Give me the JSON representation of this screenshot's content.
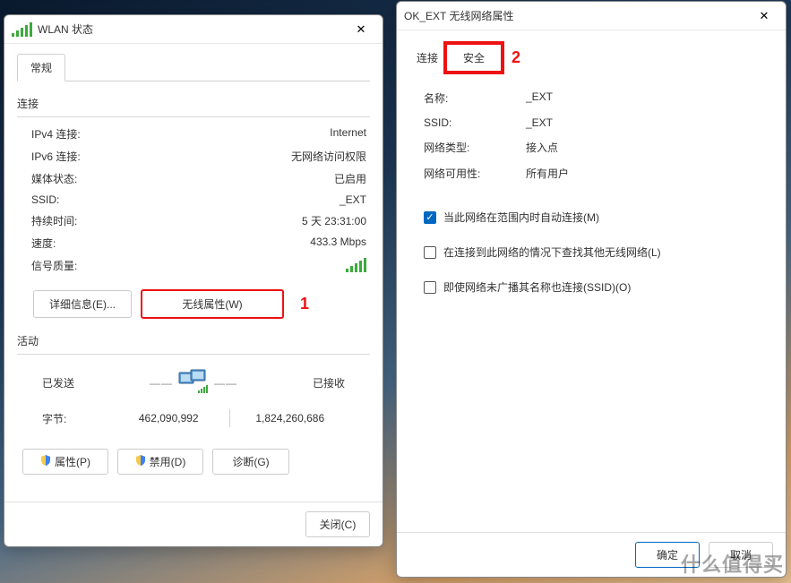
{
  "dlg1": {
    "title": "WLAN 状态",
    "tab_general": "常规",
    "section_connection": "连接",
    "rows": {
      "ipv4_label": "IPv4 连接:",
      "ipv4_value": "Internet",
      "ipv6_label": "IPv6 连接:",
      "ipv6_value": "无网络访问权限",
      "media_label": "媒体状态:",
      "media_value": "已启用",
      "ssid_label": "SSID:",
      "ssid_value": "_EXT",
      "duration_label": "持续时间:",
      "duration_value": "5 天 23:31:00",
      "speed_label": "速度:",
      "speed_value": "433.3 Mbps",
      "quality_label": "信号质量:"
    },
    "btn_details": "详细信息(E)...",
    "btn_wireless": "无线属性(W)",
    "annot1": "1",
    "section_activity": "活动",
    "activity": {
      "sent_label": "已发送",
      "recv_label": "已接收",
      "bytes_label": "字节:",
      "sent_bytes": "462,090,992",
      "recv_bytes": "1,824,260,686"
    },
    "btn_props": "属性(P)",
    "btn_disable": "禁用(D)",
    "btn_diagnose": "诊断(G)",
    "btn_close": "关闭(C)"
  },
  "dlg2": {
    "title": "OK_EXT 无线网络属性",
    "tab_connection": "连接",
    "tab_security": "安全",
    "annot2": "2",
    "rows": {
      "name_label": "名称:",
      "name_value": "_EXT",
      "ssid_label": "SSID:",
      "ssid_value": "_EXT",
      "nettype_label": "网络类型:",
      "nettype_value": "接入点",
      "avail_label": "网络可用性:",
      "avail_value": "所有用户"
    },
    "chk": {
      "auto": "当此网络在范围内时自动连接(M)",
      "look": "在连接到此网络的情况下查找其他无线网络(L)",
      "hidden": "即使网络未广播其名称也连接(SSID)(O)"
    },
    "btn_ok": "确定",
    "btn_cancel": "取消"
  },
  "watermark": "什么值得买"
}
